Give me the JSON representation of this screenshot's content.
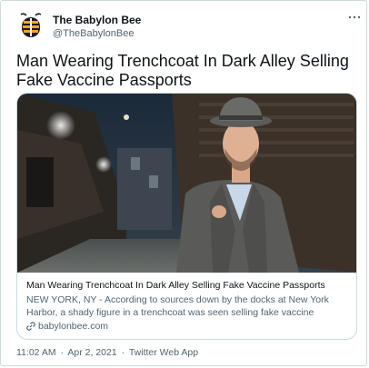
{
  "author": {
    "name": "The Babylon Bee",
    "handle": "@TheBabylonBee"
  },
  "tweet": {
    "text": "Man Wearing Trenchcoat In Dark Alley Selling Fake Vaccine Passports"
  },
  "card": {
    "title": "Man Wearing Trenchcoat In Dark Alley Selling Fake Vaccine Passports",
    "description": "NEW YORK, NY - According to sources down by the docks at New York Harbor, a shady figure in a trenchcoat was seen selling fake vaccine passports in the early ...",
    "domain": "babylonbee.com"
  },
  "meta": {
    "time": "11:02 AM",
    "separator1": "·",
    "date": "Apr 2, 2021",
    "separator2": "·",
    "source": "Twitter Web App"
  },
  "icons": {
    "avatar": "babylon-bee-logo",
    "more": "more-dots-icon",
    "link": "link-icon"
  },
  "colors": {
    "text_primary": "#0f1419",
    "text_secondary": "#536471",
    "border": "#cfd9de",
    "logo_orange": "#f5a623"
  }
}
